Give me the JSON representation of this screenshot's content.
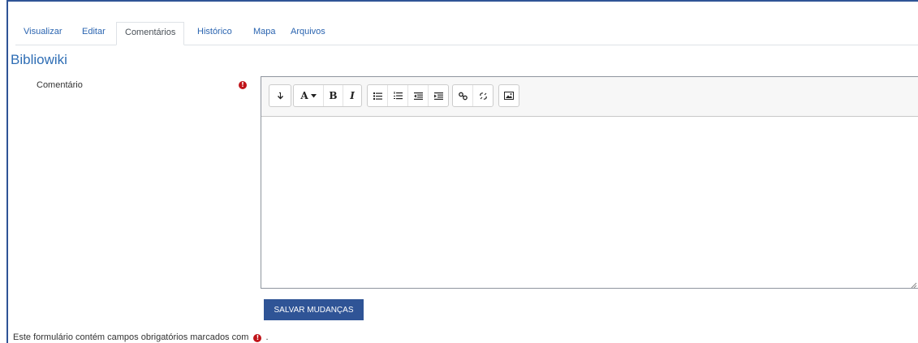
{
  "tabs": [
    {
      "label": "Visualizar",
      "active": false
    },
    {
      "label": "Editar",
      "active": false
    },
    {
      "label": "Comentários",
      "active": true
    },
    {
      "label": "Histórico",
      "active": false
    },
    {
      "label": "Mapa",
      "active": false
    },
    {
      "label": "Arquivos",
      "active": false
    }
  ],
  "page": {
    "title": "Bibliowiki"
  },
  "form": {
    "comment_label": "Comentário",
    "comment_value": "",
    "required_icon": "exclamation-circle-icon",
    "submit_label": "SALVAR MUDANÇAS",
    "required_note": "Este formulário contém campos obrigatórios marcados com",
    "required_note_end": "."
  },
  "toolbar": {
    "groups": [
      [
        "collapse-toolbar-icon"
      ],
      [
        "font-style-icon",
        "bold-icon",
        "italic-icon"
      ],
      [
        "unordered-list-icon",
        "ordered-list-icon",
        "outdent-icon",
        "indent-icon"
      ],
      [
        "link-icon",
        "unlink-icon"
      ],
      [
        "image-icon"
      ]
    ],
    "font_glyph": "A",
    "bold_glyph": "B",
    "italic_glyph": "I"
  },
  "colors": {
    "accent": "#2f5496",
    "link": "#2a64b0",
    "title": "#2f6eb5",
    "required": "#c0141a"
  }
}
